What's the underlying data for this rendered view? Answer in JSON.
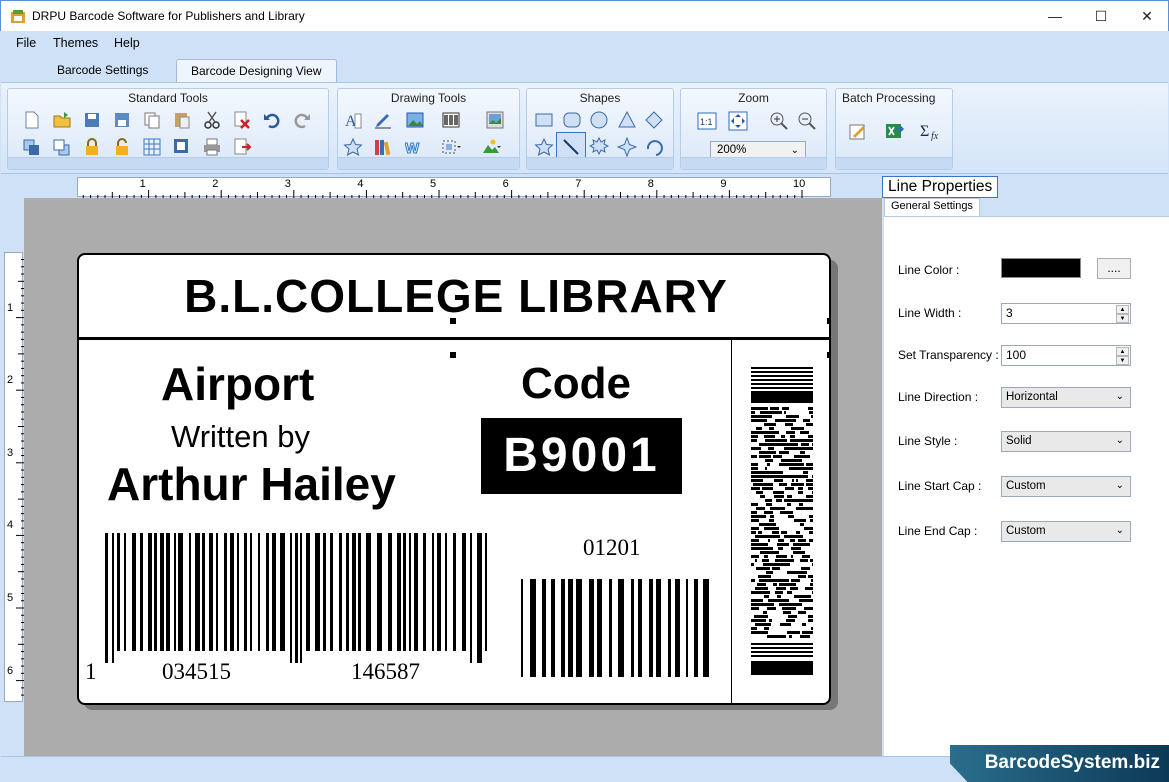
{
  "window": {
    "title": "DRPU Barcode Software for Publishers and Library"
  },
  "menu": {
    "items": [
      "File",
      "Themes",
      "Help"
    ]
  },
  "tabs": [
    "Barcode Settings",
    "Barcode Designing View"
  ],
  "ribbon": {
    "standard_tools": "Standard Tools",
    "drawing_tools": "Drawing Tools",
    "shapes": "Shapes",
    "zoom": "Zoom",
    "zoom_value": "200%",
    "batch_processing": "Batch Processing"
  },
  "ruler": {
    "h_ticks": [
      "1",
      "2",
      "3",
      "4",
      "5",
      "6",
      "7",
      "8",
      "9",
      "10"
    ],
    "v_ticks": [
      "1",
      "2",
      "3",
      "4",
      "5",
      "6"
    ]
  },
  "label": {
    "title": "B.L.COLLEGE LIBRARY",
    "book": "Airport",
    "written_by": "Written by",
    "author": "Arthur Hailey",
    "code_caption": "Code",
    "code_value": "B9001",
    "barcode_left_digits": [
      "1",
      "034515",
      "146587"
    ],
    "barcode_right_digits": "01201"
  },
  "properties": {
    "title": "Line Properties",
    "tab": "General Settings",
    "line_color_label": "Line Color :",
    "color_button": "....",
    "line_width_label": "Line Width :",
    "line_width": "3",
    "transparency_label": "Set Transparency :",
    "transparency": "100",
    "direction_label": "Line Direction :",
    "direction": "Horizontal",
    "style_label": "Line Style :",
    "style": "Solid",
    "start_cap_label": "Line Start Cap :",
    "start_cap": "Custom",
    "end_cap_label": "Line End Cap :",
    "end_cap": "Custom"
  },
  "branding": "BarcodeSystem.biz",
  "colors": {
    "accent": "#3b73c4",
    "ribbon": "#cfe1f7",
    "canvas": "#acacac"
  }
}
